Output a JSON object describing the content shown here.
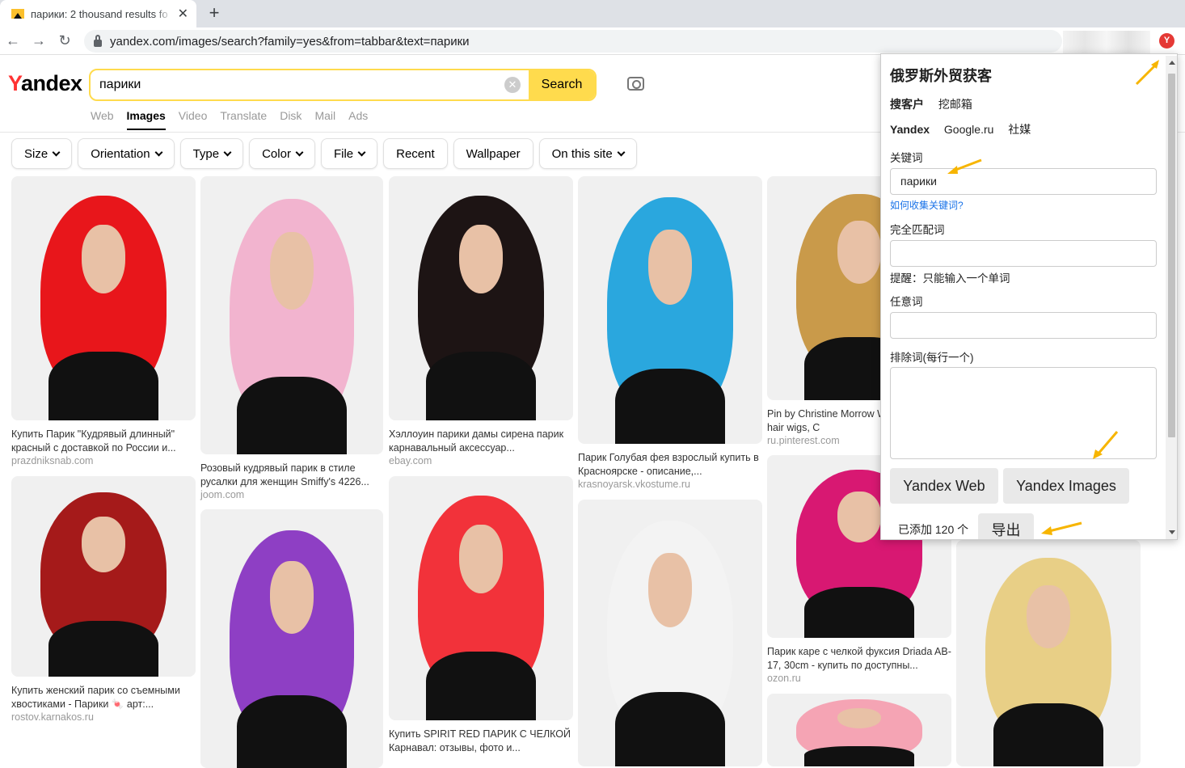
{
  "browser": {
    "tab_title": "парики: 2 thousand results fo",
    "tab_close": "✕",
    "new_tab": "+",
    "url": "yandex.com/images/search?family=yes&from=tabbar&text=парики",
    "extension_badge": "Y"
  },
  "yandex": {
    "logo_first": "Y",
    "logo_rest": "andex",
    "search_value": "парики",
    "search_button": "Search",
    "services": [
      "Web",
      "Images",
      "Video",
      "Translate",
      "Disk",
      "Mail",
      "Ads"
    ],
    "filters": [
      {
        "label": "Size",
        "dropdown": true
      },
      {
        "label": "Orientation",
        "dropdown": true
      },
      {
        "label": "Type",
        "dropdown": true
      },
      {
        "label": "Color",
        "dropdown": true
      },
      {
        "label": "File",
        "dropdown": true
      },
      {
        "label": "Recent",
        "dropdown": false
      },
      {
        "label": "Wallpaper",
        "dropdown": false
      },
      {
        "label": "On this site",
        "dropdown": true
      }
    ]
  },
  "results": [
    {
      "caption": "Купить Парик \"Кудрявый длинный\" красный с доставкой по России и...",
      "domain": "prazdniksnab.com",
      "wig_color": "#e8161b"
    },
    {
      "caption": "Розовый кудрявый парик в стиле русалки для женщин Smiffy's 4226...",
      "domain": "joom.com",
      "wig_color": "#f2b4cf"
    },
    {
      "caption": "Хэллоуин парики дамы сирена парик карнавальный аксессуар...",
      "domain": "ebay.com",
      "wig_color": "#1d1414"
    },
    {
      "caption": "Парик Голубая фея взрослый купить в Красноярске - описание,...",
      "domain": "krasnoyarsk.vkostume.ru",
      "wig_color": "#2aa7de"
    },
    {
      "caption": "Pin by Christine Morrow Wigs Human hair wigs, C",
      "domain": "ru.pinterest.com",
      "wig_color": "#c99a4a"
    },
    {
      "caption": "Купить женский парик со съемными хвостиками - Парики 🍬 арт:...",
      "domain": "rostov.karnakos.ru",
      "wig_color": "#a51a1a"
    },
    {
      "caption": "",
      "domain": "",
      "wig_color": "#8e3fc4"
    },
    {
      "caption": "Купить SPIRIT RED ПАРИК С ЧЕЛКОЙ Карнавал: отзывы, фото и...",
      "domain": "",
      "wig_color": "#f2323a"
    },
    {
      "caption": "",
      "domain": "",
      "wig_color": "#f3f3f3"
    },
    {
      "caption": "Парик каре с челкой фуксия Driada AB-17, 30cm - купить по доступны...",
      "domain": "ozon.ru",
      "wig_color": "#d81872"
    },
    {
      "caption": "",
      "domain": "",
      "wig_color": "#e8cf86"
    },
    {
      "caption": "",
      "domain": "",
      "wig_color": "#f5a4b4"
    }
  ],
  "extension_panel": {
    "title": "俄罗斯外贸获客",
    "nav_primary": [
      "搜客户",
      "挖邮箱"
    ],
    "nav_engines": [
      "Yandex",
      "Google.ru",
      "社媒"
    ],
    "keyword_label": "关键词",
    "keyword_value": "парики",
    "keyword_help": "如何收集关键词?",
    "exact_label": "完全匹配词",
    "exact_value": "",
    "exact_hint": "提醒：只能输入一个单词",
    "any_label": "任意词",
    "any_value": "",
    "exclude_label": "排除词(每行一个)",
    "btn_web": "Yandex Web",
    "btn_images": "Yandex Images",
    "added_count": "已添加 120 个",
    "export": "导出"
  },
  "colors": {
    "yandex_yellow": "#ffdb4d",
    "yandex_red": "#ff3333",
    "annotation_arrow": "#f7b500"
  }
}
